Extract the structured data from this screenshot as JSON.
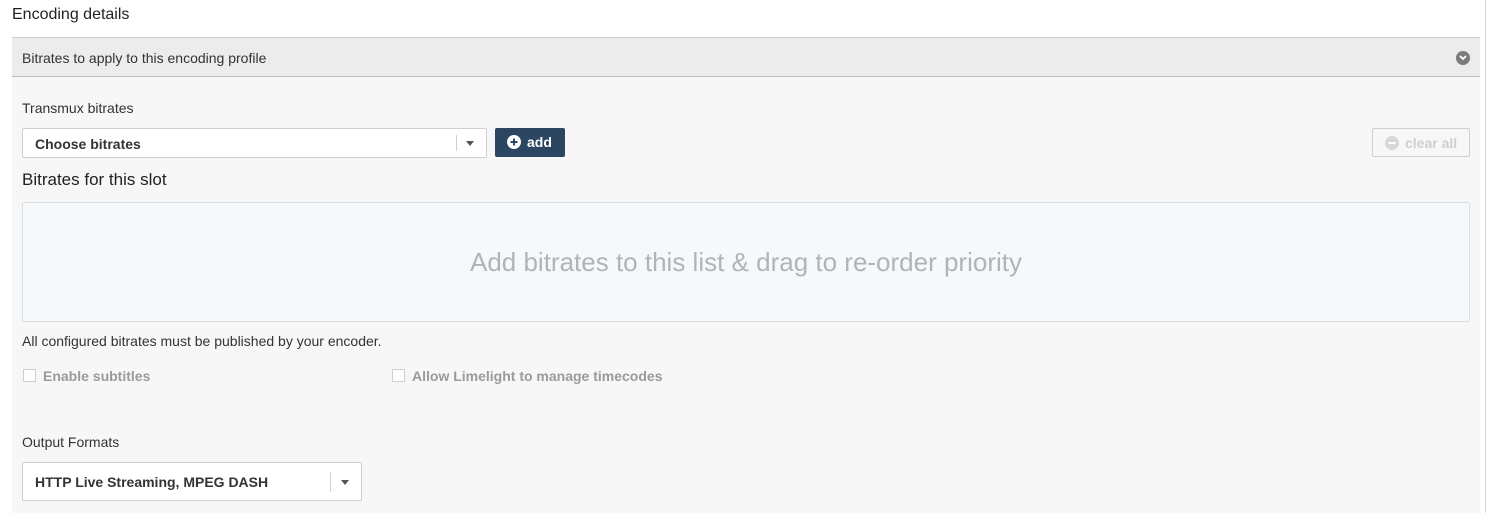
{
  "page": {
    "title": "Encoding details"
  },
  "panel": {
    "header_label": "Bitrates to apply to this encoding profile",
    "header_icon": "chevron-down-circle-icon"
  },
  "transmux": {
    "label": "Transmux bitrates",
    "select_value": "Choose bitrates",
    "add_label": "add",
    "add_icon": "plus-circle-icon",
    "clear_label": "clear all",
    "clear_icon": "minus-circle-icon"
  },
  "slot": {
    "title": "Bitrates for this slot",
    "dropzone_text": "Add bitrates to this list & drag to re-order priority",
    "note": "All configured bitrates must be published by your encoder."
  },
  "options": {
    "enable_subtitles": {
      "label": "Enable subtitles",
      "checked": false
    },
    "manage_timecodes": {
      "label": "Allow Limelight to manage timecodes",
      "checked": false
    }
  },
  "output": {
    "label": "Output Formats",
    "select_value": "HTTP Live Streaming, MPEG DASH"
  },
  "colors": {
    "primary_button": "#2c4560",
    "panel_bg": "#f7f7f7",
    "header_bg": "#ececec",
    "dropzone_bg": "#f5f9fc"
  }
}
